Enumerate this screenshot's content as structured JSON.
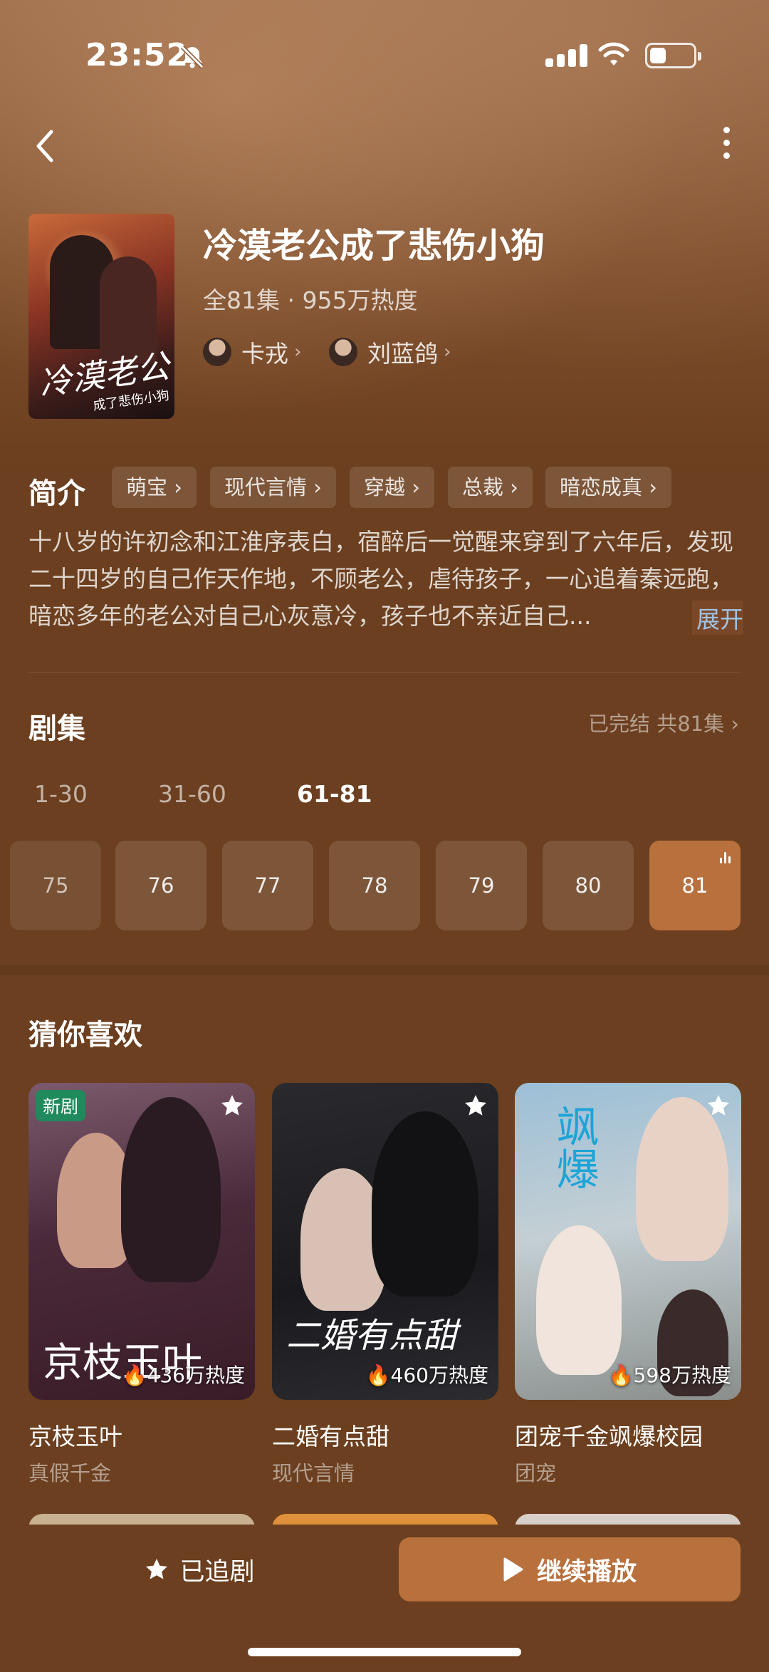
{
  "status_bar": {
    "time": "23:52"
  },
  "drama": {
    "title": "冷漠老公成了悲伤小狗",
    "meta": "全81集 · 955万热度",
    "poster_title": "冷漠老公",
    "poster_subtitle": "成了悲伤小狗",
    "cast": [
      {
        "name": "卡戎"
      },
      {
        "name": "刘蓝鸽"
      }
    ]
  },
  "intro": {
    "label": "简介",
    "tags": [
      "萌宝",
      "现代言情",
      "穿越",
      "总裁",
      "暗恋成真"
    ],
    "description": "十八岁的许初念和江淮序表白，宿醉后一觉醒来穿到了六年后，发现二十四岁的自己作天作地，不顾老公，虐待孩子，一心追着秦远跑，暗恋多年的老公对自己心灰意冷，孩子也不亲近自己...",
    "expand": "展开"
  },
  "episodes": {
    "title": "剧集",
    "status": "已完结 共81集",
    "ranges": [
      "1-30",
      "31-60",
      "61-81"
    ],
    "active_range": "61-81",
    "items": [
      "75",
      "76",
      "77",
      "78",
      "79",
      "80",
      "81"
    ],
    "current": "81"
  },
  "recommend": {
    "title": "猜你喜欢",
    "items": [
      {
        "name": "京枝玉叶",
        "tag": "真假千金",
        "heat": "436万热度",
        "badge": "新剧",
        "art": "京枝玉叶"
      },
      {
        "name": "二婚有点甜",
        "tag": "现代言情",
        "heat": "460万热度",
        "art": "二婚有点甜"
      },
      {
        "name": "团宠千金飒爆校园",
        "tag": "团宠",
        "heat": "598万热度",
        "art": "飒爆"
      }
    ]
  },
  "actions": {
    "follow": "已追剧",
    "play": "继续播放"
  },
  "colors": {
    "background": "#6b3f1f",
    "accent": "#b8703d",
    "link": "#9fc3e6",
    "new_badge": "#1f8a5c"
  }
}
